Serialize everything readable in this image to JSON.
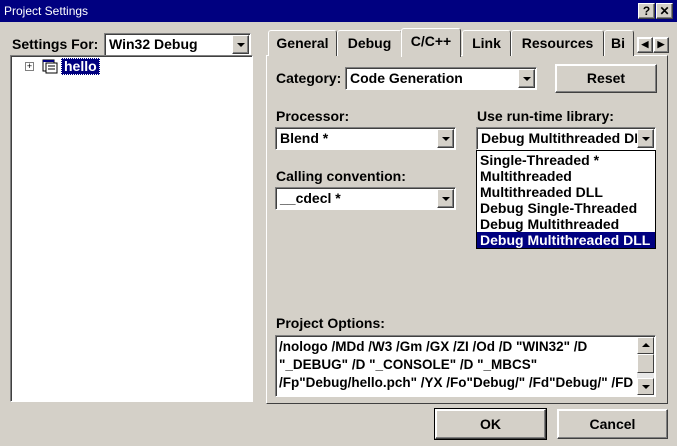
{
  "window": {
    "title": "Project Settings",
    "help_label": "?",
    "close_label": "✕"
  },
  "left": {
    "settings_for_label": "Settings For:",
    "settings_for_value": "Win32 Debug",
    "tree": {
      "expander": "+",
      "project_name": "hello"
    }
  },
  "tabs": [
    {
      "label": "General"
    },
    {
      "label": "Debug"
    },
    {
      "label": "C/C++"
    },
    {
      "label": "Link"
    },
    {
      "label": "Resources"
    },
    {
      "label": "Bi"
    }
  ],
  "active_tab": "C/C++",
  "panel": {
    "category_label": "Category:",
    "category_value": "Code Generation",
    "reset_label": "Reset",
    "processor_label": "Processor:",
    "processor_value": "Blend *",
    "runtime_label": "Use run-time library:",
    "runtime_value": "Debug Multithreaded DL",
    "runtime_options": [
      "Single-Threaded *",
      "Multithreaded",
      "Multithreaded DLL",
      "Debug Single-Threaded",
      "Debug Multithreaded",
      "Debug Multithreaded DLL"
    ],
    "runtime_selected_index": 5,
    "calling_label": "Calling convention:",
    "calling_value": "__cdecl *",
    "project_options_label": "Project Options:",
    "project_options_lines": [
      "/nologo /MDd /W3 /Gm /GX /ZI /Od /D \"WIN32\" /D",
      "\"_DEBUG\" /D \"_CONSOLE\" /D \"_MBCS\"",
      "/Fp\"Debug/hello.pch\" /YX /Fo\"Debug/\" /Fd\"Debug/\" /FD"
    ]
  },
  "footer": {
    "ok_label": "OK",
    "cancel_label": "Cancel"
  }
}
